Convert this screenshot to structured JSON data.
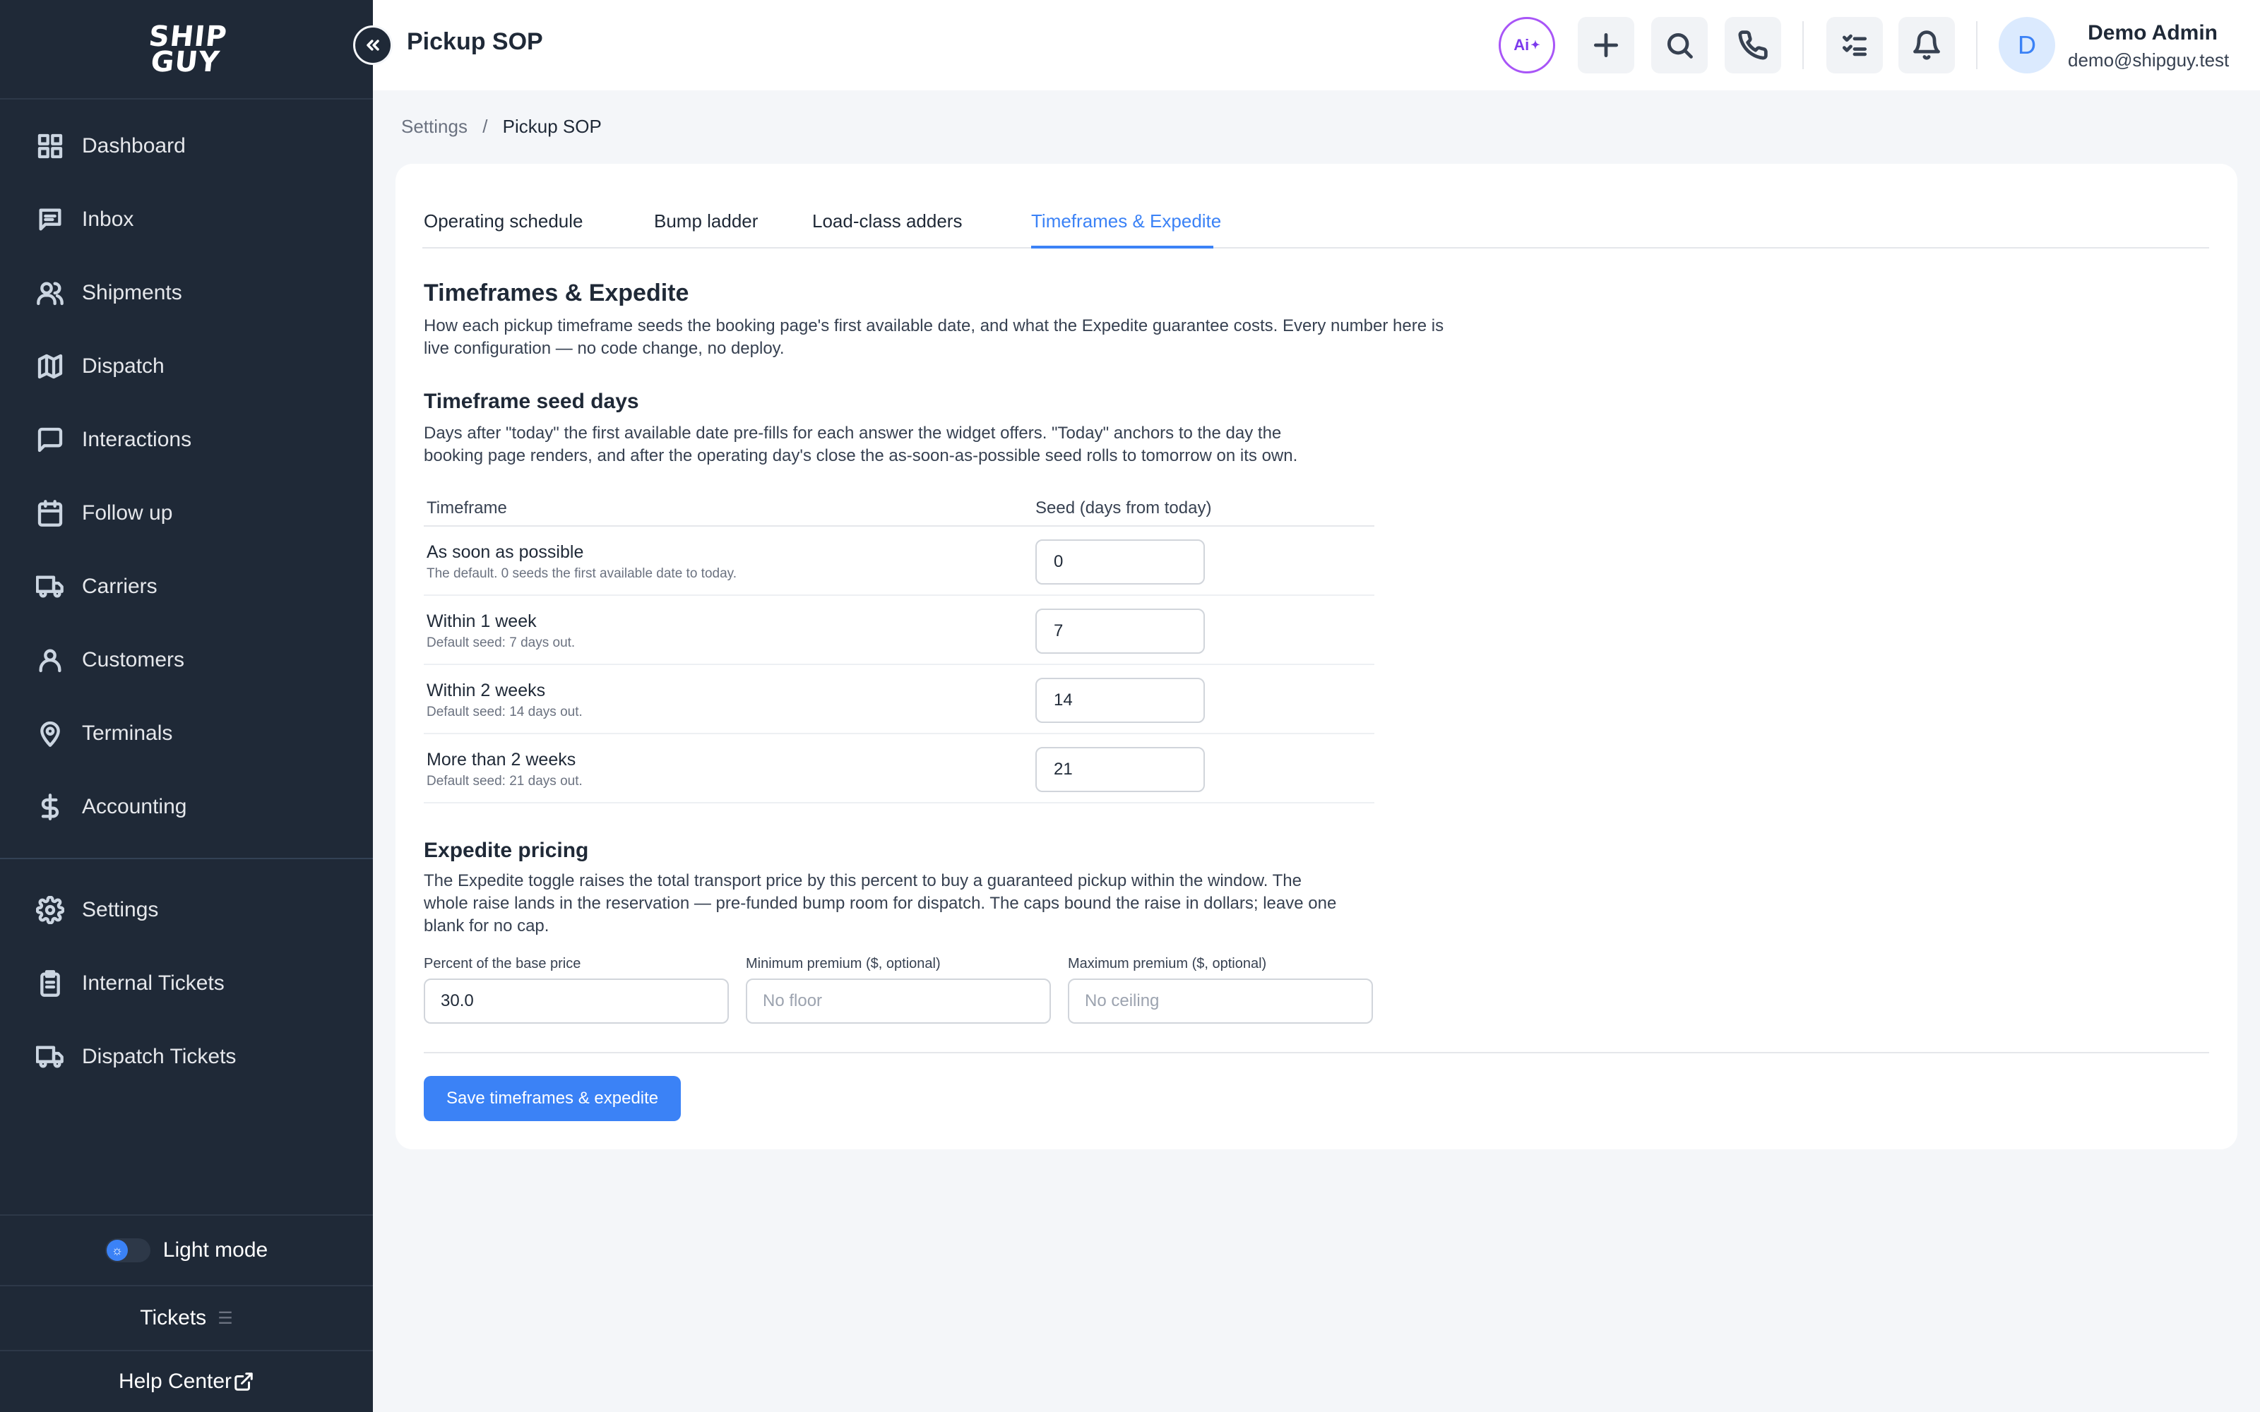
{
  "sidebar": {
    "logo": "SHIP GUY",
    "items": [
      {
        "label": "Dashboard",
        "icon": "grid-icon"
      },
      {
        "label": "Inbox",
        "icon": "inbox-icon"
      },
      {
        "label": "Shipments",
        "icon": "users-icon"
      },
      {
        "label": "Dispatch",
        "icon": "map-icon"
      },
      {
        "label": "Interactions",
        "icon": "message-icon"
      },
      {
        "label": "Follow up",
        "icon": "calendar-icon"
      },
      {
        "label": "Carriers",
        "icon": "truck-icon"
      },
      {
        "label": "Customers",
        "icon": "user-icon"
      },
      {
        "label": "Terminals",
        "icon": "map-pin-icon"
      },
      {
        "label": "Accounting",
        "icon": "dollar-icon"
      }
    ],
    "secondary_items": [
      {
        "label": "Settings",
        "icon": "gear-icon"
      },
      {
        "label": "Internal Tickets",
        "icon": "clipboard-icon"
      },
      {
        "label": "Dispatch Tickets",
        "icon": "truck-icon"
      }
    ],
    "theme_toggle_label": "Light mode",
    "tickets_label": "Tickets",
    "help_center_label": "Help Center"
  },
  "header": {
    "title": "Pickup SOP",
    "ai_label": "Ai",
    "user_initial": "D",
    "user_name": "Demo Admin",
    "user_email": "demo@shipguy.test"
  },
  "breadcrumb": {
    "parent": "Settings",
    "separator": "/",
    "current": "Pickup SOP"
  },
  "tabs": [
    {
      "label": "Operating schedule",
      "active": false
    },
    {
      "label": "Bump ladder",
      "active": false
    },
    {
      "label": "Load-class adders",
      "active": false
    },
    {
      "label": "Timeframes & Expedite",
      "active": true
    }
  ],
  "section": {
    "title": "Timeframes & Expedite",
    "description_line1": "How each pickup timeframe seeds the booking page's first available date, and what the Expedite guarantee costs. Every number here is",
    "description_line2": "live configuration — no code change, no deploy."
  },
  "seed_days": {
    "title": "Timeframe seed days",
    "description_line1": "Days after \"today\" the first available date pre-fills for each answer the widget offers. \"Today\" anchors to the day the",
    "description_line2": "booking page renders, and after the operating day's close the as-soon-as-possible seed rolls to tomorrow on its own.",
    "columns": [
      "Timeframe",
      "Seed (days from today)"
    ],
    "rows": [
      {
        "label": "As soon as possible",
        "sub": "The default. 0 seeds the first available date to today.",
        "value": "0"
      },
      {
        "label": "Within 1 week",
        "sub": "Default seed: 7 days out.",
        "value": "7"
      },
      {
        "label": "Within 2 weeks",
        "sub": "Default seed: 14 days out.",
        "value": "14"
      },
      {
        "label": "More than 2 weeks",
        "sub": "Default seed: 21 days out.",
        "value": "21"
      }
    ]
  },
  "expedite": {
    "title": "Expedite pricing",
    "description_line1": "The Expedite toggle raises the total transport price by this percent to buy a guaranteed pickup within the window. The",
    "description_line2": "whole raise lands in the reservation — pre-funded bump room for dispatch. The caps bound the raise in dollars; leave one",
    "description_line3": "blank for no cap.",
    "percent_label": "Percent of the base price",
    "percent_value": "30.0",
    "min_label": "Minimum premium ($, optional)",
    "min_placeholder": "No floor",
    "max_label": "Maximum premium ($, optional)",
    "max_placeholder": "No ceiling"
  },
  "save_label": "Save timeframes & expedite",
  "colors": {
    "sidebar_bg": "#1f2937",
    "accent": "#3b82f6",
    "page_bg": "#f4f6f9"
  }
}
